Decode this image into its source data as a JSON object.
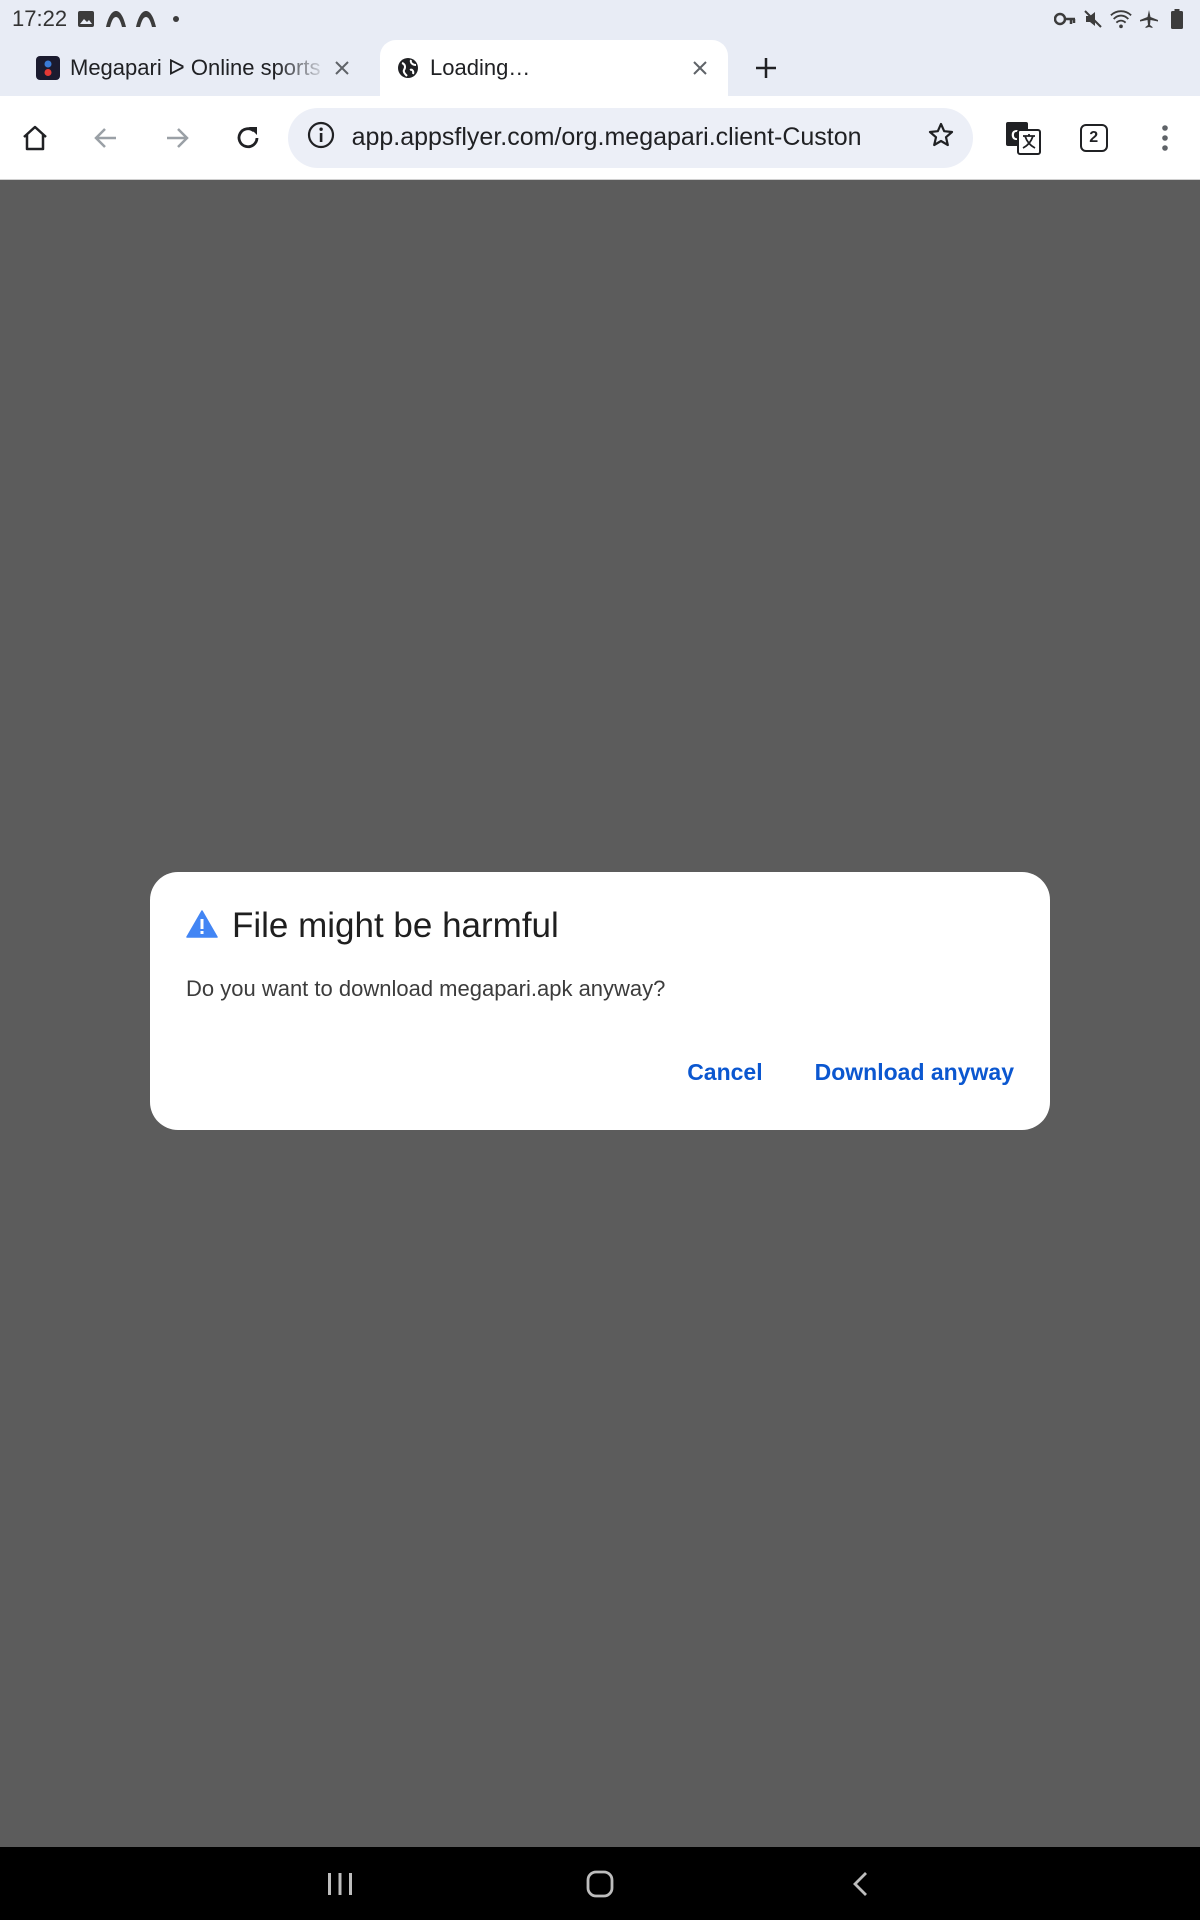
{
  "status_bar": {
    "time": "17:22",
    "left_icons": [
      "gallery-icon",
      "vpn-mountain-icon",
      "vpn-mountain-icon",
      "dot-icon"
    ],
    "right_icons": [
      "key-icon",
      "mute-icon",
      "wifi-icon",
      "airplane-icon",
      "battery-icon"
    ]
  },
  "tabs": [
    {
      "title": "Megapari ᐅ Online sports",
      "active": false
    },
    {
      "title": "Loading…",
      "active": true
    }
  ],
  "toolbar": {
    "url": "app.appsflyer.com/org.megapari.client-Custon",
    "tab_count": "2"
  },
  "dialog": {
    "title": "File might be harmful",
    "body": "Do you want to download megapari.apk anyway?",
    "cancel_label": "Cancel",
    "download_label": "Download anyway"
  },
  "colors": {
    "accent": "#0b57d0",
    "warning": "#4285f4",
    "scrim": "#5c5c5c",
    "chrome_bg": "#e8ecf5"
  }
}
